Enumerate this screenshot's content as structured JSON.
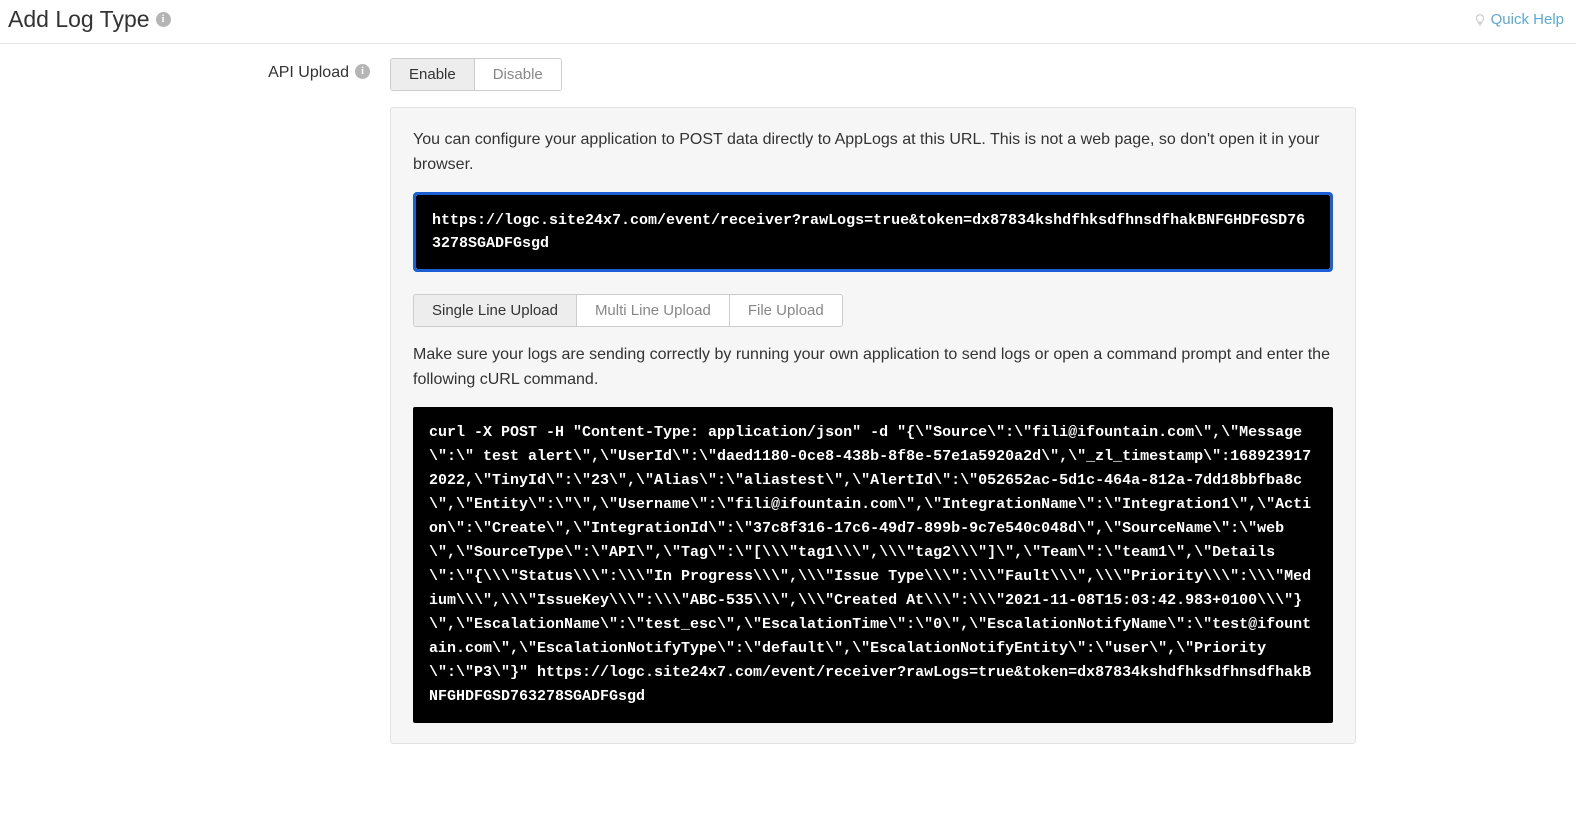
{
  "header": {
    "title": "Add Log Type",
    "quick_help": "Quick Help"
  },
  "sidebar": {
    "api_upload_label": "API Upload"
  },
  "toggle": {
    "enable": "Enable",
    "disable": "Disable"
  },
  "panel": {
    "desc1": "You can configure your application to POST data directly to AppLogs at this URL. This is not a web page, so don't open it in your browser.",
    "url": "https://logc.site24x7.com/event/receiver?rawLogs=true&token=dx87834kshdfhksdfhnsdfhakBNFGHDFGSD763278SGADFGsgd",
    "tabs": {
      "single": "Single Line Upload",
      "multi": "Multi Line Upload",
      "file": "File Upload"
    },
    "desc2": "Make sure your logs are sending correctly by running your own application to send logs or open a command prompt and enter the following cURL command.",
    "curl": "curl -X POST -H \"Content-Type: application/json\" -d \"{\\\"Source\\\":\\\"fili@ifountain.com\\\",\\\"Message\\\":\\\" test alert\\\",\\\"UserId\\\":\\\"daed1180-0ce8-438b-8f8e-57e1a5920a2d\\\",\\\"_zl_timestamp\\\":1689239172022,\\\"TinyId\\\":\\\"23\\\",\\\"Alias\\\":\\\"aliastest\\\",\\\"AlertId\\\":\\\"052652ac-5d1c-464a-812a-7dd18bbfba8c\\\",\\\"Entity\\\":\\\"\\\",\\\"Username\\\":\\\"fili@ifountain.com\\\",\\\"IntegrationName\\\":\\\"Integration1\\\",\\\"Action\\\":\\\"Create\\\",\\\"IntegrationId\\\":\\\"37c8f316-17c6-49d7-899b-9c7e540c048d\\\",\\\"SourceName\\\":\\\"web\\\",\\\"SourceType\\\":\\\"API\\\",\\\"Tag\\\":\\\"[\\\\\\\"tag1\\\\\\\",\\\\\\\"tag2\\\\\\\"]\\\",\\\"Team\\\":\\\"team1\\\",\\\"Details\\\":\\\"{\\\\\\\"Status\\\\\\\":\\\\\\\"In Progress\\\\\\\",\\\\\\\"Issue Type\\\\\\\":\\\\\\\"Fault\\\\\\\",\\\\\\\"Priority\\\\\\\":\\\\\\\"Medium\\\\\\\",\\\\\\\"IssueKey\\\\\\\":\\\\\\\"ABC-535\\\\\\\",\\\\\\\"Created At\\\\\\\":\\\\\\\"2021-11-08T15:03:42.983+0100\\\\\\\"}\\\",\\\"EscalationName\\\":\\\"test_esc\\\",\\\"EscalationTime\\\":\\\"0\\\",\\\"EscalationNotifyName\\\":\\\"test@ifountain.com\\\",\\\"EscalationNotifyType\\\":\\\"default\\\",\\\"EscalationNotifyEntity\\\":\\\"user\\\",\\\"Priority\\\":\\\"P3\\\"}\" https://logc.site24x7.com/event/receiver?rawLogs=true&token=dx87834kshdfhksdfhnsdfhakBNFGHDFGSD763278SGADFGsgd"
  }
}
